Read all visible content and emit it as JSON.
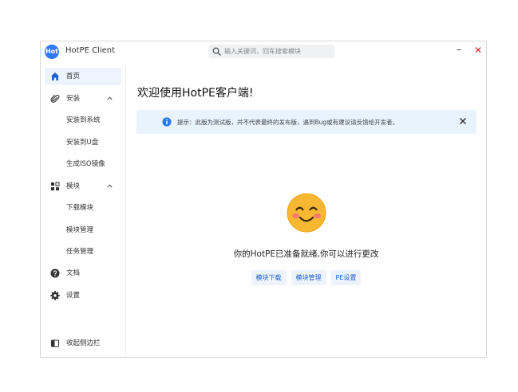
{
  "app": {
    "title": "HotPE Client",
    "logo_text": "Hot"
  },
  "search": {
    "placeholder": "输入关键词，回车搜索模块"
  },
  "window_controls": {
    "minimize": "–",
    "close": "✕"
  },
  "sidebar": {
    "items": [
      {
        "label": "首页",
        "icon": "home-icon",
        "active": true
      },
      {
        "label": "安装",
        "icon": "paperclip-icon",
        "expanded": true
      },
      {
        "label": "安装到系统"
      },
      {
        "label": "安装到U盘"
      },
      {
        "label": "生成ISO镜像"
      },
      {
        "label": "模块",
        "icon": "grid-icon",
        "expanded": true
      },
      {
        "label": "下载模块"
      },
      {
        "label": "模块管理"
      },
      {
        "label": "任务管理"
      },
      {
        "label": "文档",
        "icon": "help-circle-icon"
      },
      {
        "label": "设置",
        "icon": "gear-icon"
      }
    ],
    "collapse_label": "收起侧边栏"
  },
  "main": {
    "title": "欢迎使用HotPE客户端!",
    "notice": "提示：此版为测试版，并不代表最终的发布版，遇到Bug或有建议请反馈给开发者。",
    "ready_text": "你的HotPE已准备就绪,你可以进行更改",
    "actions": [
      "模块下载",
      "模块管理",
      "PE设置"
    ]
  },
  "colors": {
    "accent": "#2f7bf5",
    "notice_bg": "#e9f3fd",
    "close_red": "#e02020",
    "smiley": "#f7b731"
  }
}
